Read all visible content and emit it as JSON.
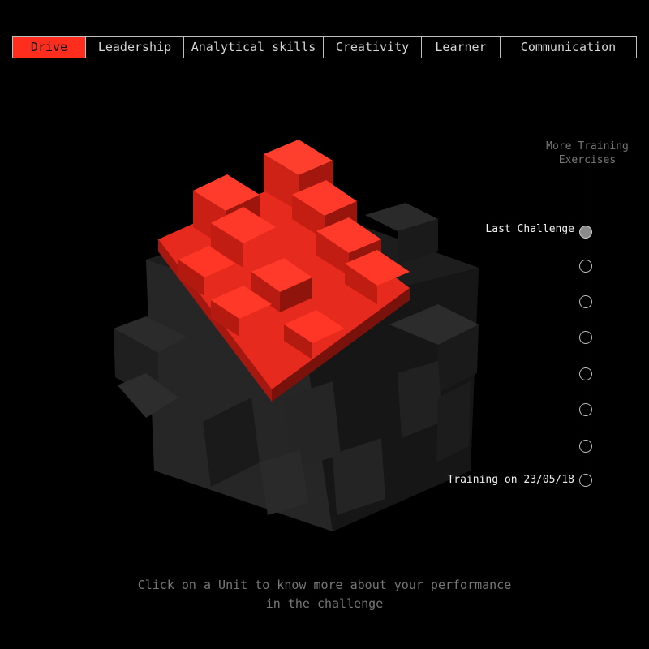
{
  "tabs": [
    {
      "label": "Drive",
      "active": true
    },
    {
      "label": "Leadership"
    },
    {
      "label": "Analytical skills"
    },
    {
      "label": "Creativity"
    },
    {
      "label": "Learner"
    },
    {
      "label": "Communication"
    }
  ],
  "timeline": {
    "more_label_line1": "More Training",
    "more_label_line2": "Exercises",
    "last_challenge": "Last Challenge",
    "training_date": "Training on 23/05/18"
  },
  "hint": {
    "line1": "Click on a Unit to know more about your performance",
    "line2": "in the challenge"
  },
  "colors": {
    "accent": "#ff2d1e",
    "cube_dark": "#2a2a2a"
  }
}
